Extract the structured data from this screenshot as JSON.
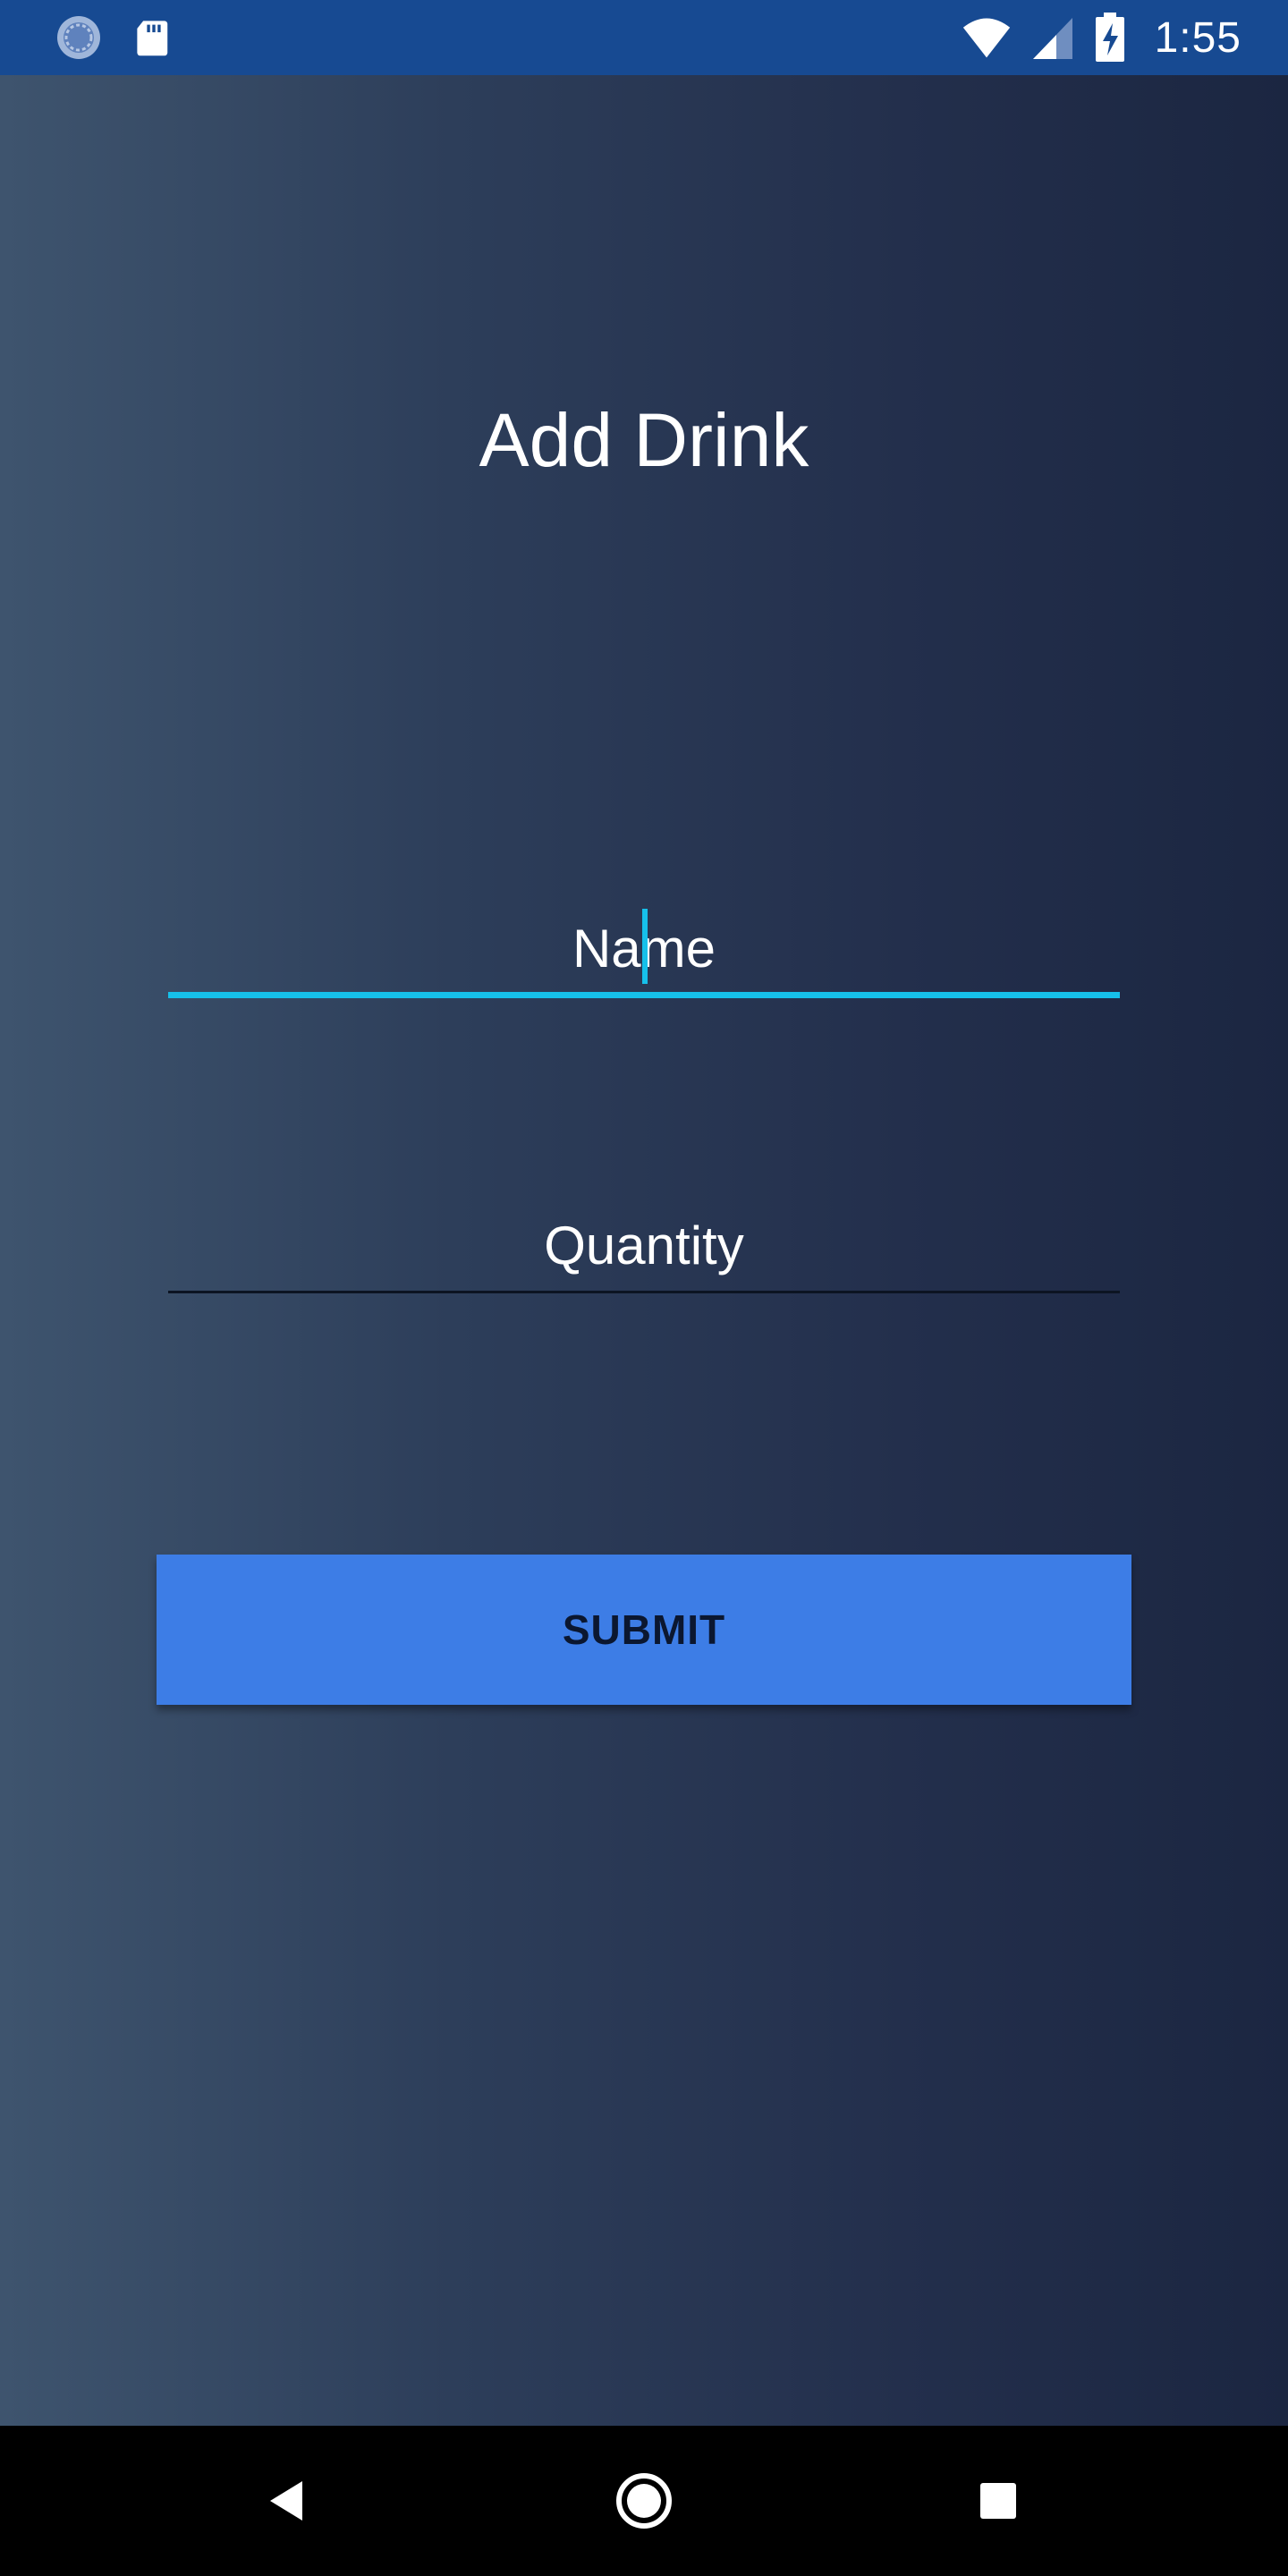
{
  "status_bar": {
    "time": "1:55",
    "icons": [
      "sync-icon",
      "sd-card-icon",
      "wifi-icon",
      "cell-signal-icon",
      "battery-charging-icon"
    ],
    "background": "#174a92"
  },
  "screen": {
    "title": "Add Drink"
  },
  "form": {
    "name_placeholder": "Name",
    "quantity_placeholder": "Quantity",
    "submit_label": "SUBMIT",
    "active_accent": "#16c0ea",
    "button_color": "#3d7de6"
  },
  "nav_bar": {
    "icons": [
      "back-icon",
      "home-icon",
      "recents-icon"
    ]
  }
}
